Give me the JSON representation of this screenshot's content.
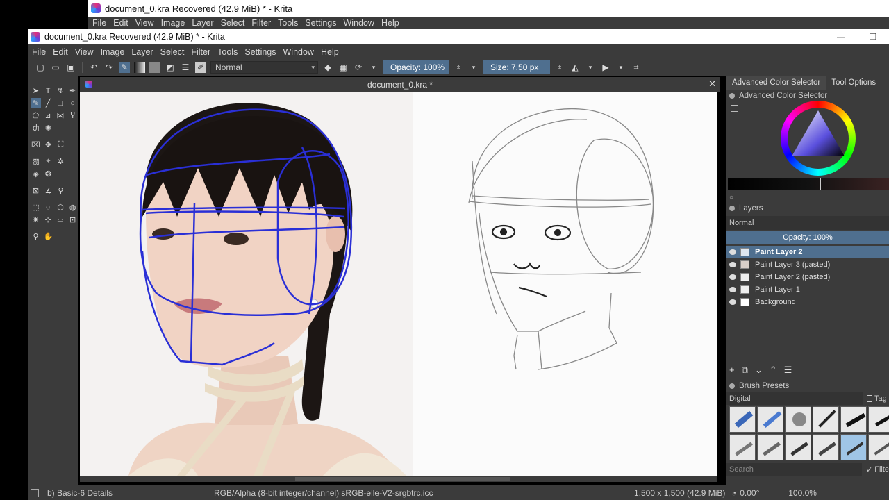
{
  "bg_window": {
    "title": "document_0.kra Recovered  (42.9 MiB)  * - Krita",
    "menu": [
      "File",
      "Edit",
      "View",
      "Image",
      "Layer",
      "Select",
      "Filter",
      "Tools",
      "Settings",
      "Window",
      "Help"
    ]
  },
  "window": {
    "title": "document_0.kra Recovered  (42.9 MiB)  * - Krita",
    "minimize": "—",
    "restore": "❐",
    "menu": [
      "File",
      "Edit",
      "View",
      "Image",
      "Layer",
      "Select",
      "Filter",
      "Tools",
      "Settings",
      "Window",
      "Help"
    ]
  },
  "toolbar": {
    "blend_mode": "Normal",
    "opacity": "Opacity: 100%",
    "size": "Size: 7.50 px"
  },
  "canvas": {
    "tab_title": "document_0.kra *",
    "close": "✕"
  },
  "dockers": {
    "tabs": [
      "Advanced Color Selector",
      "Tool Options"
    ],
    "color_selector_header": "Advanced Color Selector",
    "layers_header": "Layers",
    "layers_blend": "Normal",
    "layers_opacity": "Opacity:  100%",
    "layers": [
      {
        "name": "Paint Layer 2",
        "selected": true
      },
      {
        "name": "Paint Layer 3 (pasted)",
        "selected": false
      },
      {
        "name": "Paint Layer 2 (pasted)",
        "selected": false
      },
      {
        "name": "Paint Layer 1",
        "selected": false
      },
      {
        "name": "Background",
        "selected": false
      }
    ],
    "brush_presets_header": "Brush Presets",
    "brush_tag": "Digital",
    "tag_button": "Tag",
    "search_placeholder": "Search",
    "filter_label": "Filte"
  },
  "status": {
    "brush": "b) Basic-6 Details",
    "color_model": "RGB/Alpha (8-bit integer/channel)  sRGB-elle-V2-srgbtrc.icc",
    "dimensions": "1,500 x 1,500 (42.9 MiB)",
    "rotation": "0.00°",
    "zoom": "100.0%"
  },
  "colors": {
    "accent": "#4f6f8f",
    "panel": "#3b3b3b",
    "guide_lines": "#2a2fd6"
  }
}
